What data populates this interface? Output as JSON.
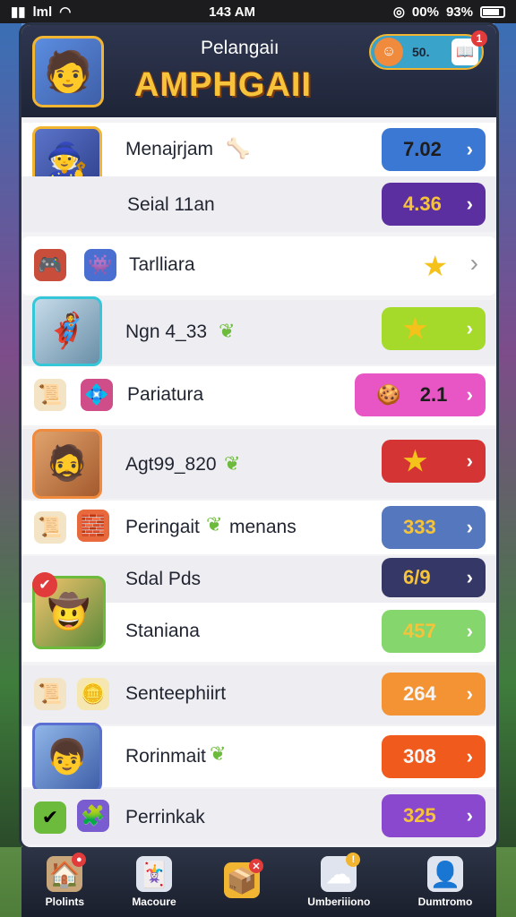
{
  "status": {
    "left": "lml",
    "time": "143 AM",
    "right_a": "00%",
    "right_b": "93%"
  },
  "header": {
    "subtitle": "Pelangaiı",
    "title": "AMPHGAII",
    "coins": "50."
  },
  "rows": [
    {
      "label": "Menajrjam",
      "value": "7.02",
      "color": "#3a78d4"
    },
    {
      "label": "Seial 11an",
      "value": "4.36",
      "color": "#5b2fa0"
    },
    {
      "label": "Tarlliara",
      "value": "",
      "color": "#ffffff"
    },
    {
      "label": "Ngn 4_33",
      "value": "",
      "color": "#a5d92a"
    },
    {
      "label": "Pariatura",
      "value": "2.1",
      "color": "#e856c6"
    },
    {
      "label": "Agt99_820",
      "value": "",
      "color": "#d53434"
    },
    {
      "label": "Peringait",
      "label2": "menans",
      "value": "333",
      "color": "#5577bd"
    },
    {
      "label": "Sdal Pds",
      "value": "6/9",
      "color": "#353766"
    },
    {
      "label": "Staniana",
      "value": "457",
      "color": "#85d66c"
    },
    {
      "label": "Senteephiirt",
      "value": "264",
      "color": "#f49334"
    },
    {
      "label": "Rorinmait",
      "value": "308",
      "color": "#f05a1c"
    },
    {
      "label": "Perrinkak",
      "value": "325",
      "color": "#8a48cf"
    }
  ],
  "nav": [
    {
      "label": "Plolints"
    },
    {
      "label": "Macoure"
    },
    {
      "label": ""
    },
    {
      "label": "Umberiiiono"
    },
    {
      "label": "Dumtromo"
    }
  ],
  "icons": {
    "avatar": "hero-portrait-icon",
    "chevron": "chevron-right-icon",
    "star": "star-icon"
  }
}
